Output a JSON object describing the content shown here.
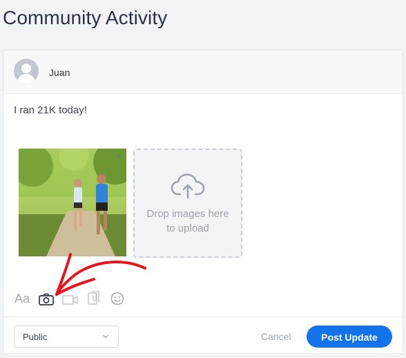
{
  "page": {
    "title": "Community Activity"
  },
  "composer": {
    "username": "Juan",
    "post_text": "I ran 21K today!",
    "remove_label": "×",
    "dropzone_line1": "Drop images here",
    "dropzone_line2": "to upload",
    "font_icon_label": "Aa",
    "icons": [
      "font-size-icon",
      "camera-icon",
      "video-icon",
      "attachment-icon",
      "emoji-icon"
    ]
  },
  "footer": {
    "visibility_value": "Public",
    "cancel_label": "Cancel",
    "submit_label": "Post Update"
  },
  "colors": {
    "accent": "#1273eb",
    "annotation_arrow": "#e8141d"
  }
}
